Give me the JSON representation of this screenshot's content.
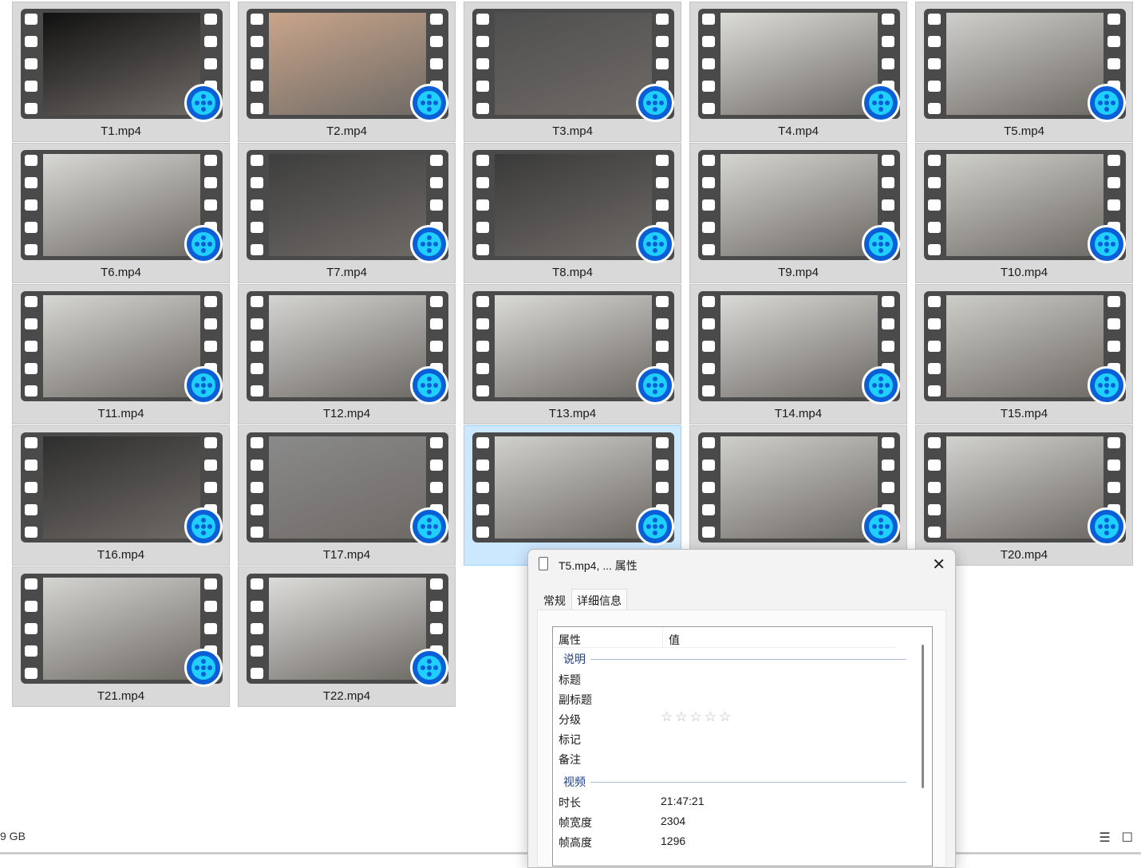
{
  "files": [
    {
      "label": "T1.mp4",
      "tone": "#111111"
    },
    {
      "label": "T2.mp4",
      "tone": "#c9a58a"
    },
    {
      "label": "T3.mp4",
      "tone": "#4f4f4f"
    },
    {
      "label": "T4.mp4",
      "tone": "#dcdcd6"
    },
    {
      "label": "T5.mp4",
      "tone": "#cfcfcb"
    },
    {
      "label": "T6.mp4",
      "tone": "#d8d8d4"
    },
    {
      "label": "T7.mp4",
      "tone": "#3e3e3e"
    },
    {
      "label": "T8.mp4",
      "tone": "#3a3a3a"
    },
    {
      "label": "T9.mp4",
      "tone": "#d5d5d0"
    },
    {
      "label": "T10.mp4",
      "tone": "#cfcfca"
    },
    {
      "label": "T11.mp4",
      "tone": "#d6d6d2"
    },
    {
      "label": "T12.mp4",
      "tone": "#d4d4d0"
    },
    {
      "label": "T13.mp4",
      "tone": "#dadad6"
    },
    {
      "label": "T14.mp4",
      "tone": "#d9d9d5"
    },
    {
      "label": "T15.mp4",
      "tone": "#cdcdc8"
    },
    {
      "label": "T16.mp4",
      "tone": "#2e2e2e"
    },
    {
      "label": "T17.mp4",
      "tone": "#8a8a8a"
    },
    {
      "label": "",
      "tone": "#d0d0cc"
    },
    {
      "label": "",
      "tone": "#cfcfca"
    },
    {
      "label": "T20.mp4",
      "tone": "#d2d2ce"
    },
    {
      "label": "T21.mp4",
      "tone": "#d4d4d0"
    },
    {
      "label": "T22.mp4",
      "tone": "#dcdcd8"
    }
  ],
  "status": {
    "size_text": "9 GB"
  },
  "dialog": {
    "title": "T5.mp4, ... 属性",
    "close": "✕",
    "tabs": [
      "常规",
      "详细信息"
    ],
    "header": {
      "property": "属性",
      "value": "值"
    },
    "sections": {
      "description": "说明",
      "video": "视频"
    },
    "rows": {
      "title": "标题",
      "subtitle": "副标题",
      "rating": "分级",
      "tags": "标记",
      "comments": "备注",
      "duration": "时长",
      "width": "帧宽度",
      "height": "帧高度"
    },
    "values": {
      "rating_stars": "☆☆☆☆☆",
      "duration": "21:47:21",
      "width": "2304",
      "height": "1296"
    }
  }
}
